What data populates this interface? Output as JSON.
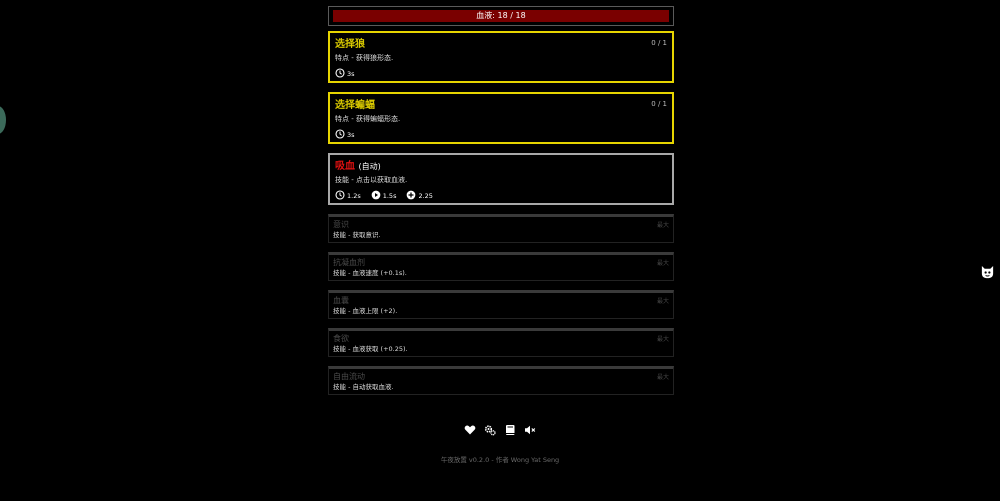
{
  "blood": {
    "label": "血液: 18 / 18",
    "fill_fraction": 1.0
  },
  "skills_active": [
    {
      "title": "选择狼",
      "suffix": "",
      "count": "0 / 1",
      "desc": "特点 - 获得狼形态.",
      "stats": [
        {
          "icon": "clock-icon",
          "value": "3s"
        }
      ]
    },
    {
      "title": "选择蝙蝠",
      "suffix": "",
      "count": "0 / 1",
      "desc": "特点 - 获得蝙蝠形态.",
      "stats": [
        {
          "icon": "clock-icon",
          "value": "3s"
        }
      ]
    },
    {
      "title": "吸血",
      "suffix": "(自动)",
      "count": "",
      "desc": "技能 - 点击以获取血液.",
      "stats": [
        {
          "icon": "clock-icon",
          "value": "1.2s"
        },
        {
          "icon": "play-icon",
          "value": "1.5s"
        },
        {
          "icon": "plus-circle-icon",
          "value": "2.25"
        }
      ]
    }
  ],
  "skills_locked": [
    {
      "title": "意识",
      "max": "最大",
      "desc": "技能 - 获取意识."
    },
    {
      "title": "抗凝血剂",
      "max": "最大",
      "desc": "技能 - 血液速度 (+0.1s)."
    },
    {
      "title": "血囊",
      "max": "最大",
      "desc": "技能 - 血液上限 (+2)."
    },
    {
      "title": "食欲",
      "max": "最大",
      "desc": "技能 - 血液获取 (+0.25)."
    },
    {
      "title": "自由流动",
      "max": "最大",
      "desc": "技能 - 自动获取血液."
    }
  ],
  "toolbar": {
    "icons": [
      "heart-icon",
      "gears-icon",
      "book-icon",
      "mute-icon"
    ]
  },
  "footer": {
    "text": "午夜放置 v0.2.0 - 作者 Wong Yat Seng"
  },
  "colors": {
    "blood_fill": "#7a0000",
    "selected_border": "#e6d400",
    "skill_title": "#d8c800",
    "active_title": "#e01010"
  }
}
